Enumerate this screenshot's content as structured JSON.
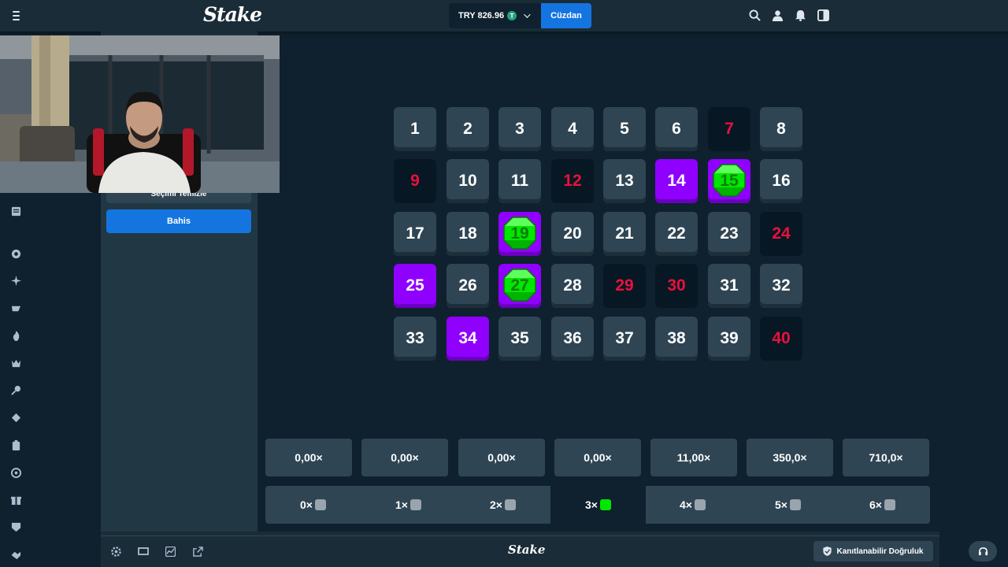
{
  "header": {
    "logo": "Stake",
    "balance": "TRY 826.96",
    "currency_symbol": "T",
    "wallet_label": "Cüzdan"
  },
  "sidebar": {
    "icons": [
      "menu-icon",
      "news-icon",
      "casino-chip-icon",
      "sparkle-icon",
      "sports-icon",
      "fire-icon",
      "crown-icon",
      "racket-icon",
      "poker-icon",
      "clipboard-icon",
      "support-circle-icon",
      "gift-icon",
      "vip-icon",
      "handshake-icon"
    ]
  },
  "controls": {
    "clear_label": "Seçimi Temizle",
    "bet_label": "Bahis"
  },
  "board": {
    "tiles": [
      {
        "n": "1",
        "s": "normal"
      },
      {
        "n": "2",
        "s": "normal"
      },
      {
        "n": "3",
        "s": "normal"
      },
      {
        "n": "4",
        "s": "normal"
      },
      {
        "n": "5",
        "s": "normal"
      },
      {
        "n": "6",
        "s": "normal"
      },
      {
        "n": "7",
        "s": "miss"
      },
      {
        "n": "8",
        "s": "normal"
      },
      {
        "n": "9",
        "s": "miss"
      },
      {
        "n": "10",
        "s": "normal"
      },
      {
        "n": "11",
        "s": "normal"
      },
      {
        "n": "12",
        "s": "miss"
      },
      {
        "n": "13",
        "s": "normal"
      },
      {
        "n": "14",
        "s": "picked"
      },
      {
        "n": "15",
        "s": "gem"
      },
      {
        "n": "16",
        "s": "normal"
      },
      {
        "n": "17",
        "s": "normal"
      },
      {
        "n": "18",
        "s": "normal"
      },
      {
        "n": "19",
        "s": "gem"
      },
      {
        "n": "20",
        "s": "normal"
      },
      {
        "n": "21",
        "s": "normal"
      },
      {
        "n": "22",
        "s": "normal"
      },
      {
        "n": "23",
        "s": "normal"
      },
      {
        "n": "24",
        "s": "miss"
      },
      {
        "n": "25",
        "s": "picked"
      },
      {
        "n": "26",
        "s": "normal"
      },
      {
        "n": "27",
        "s": "gem"
      },
      {
        "n": "28",
        "s": "normal"
      },
      {
        "n": "29",
        "s": "miss"
      },
      {
        "n": "30",
        "s": "miss"
      },
      {
        "n": "31",
        "s": "normal"
      },
      {
        "n": "32",
        "s": "normal"
      },
      {
        "n": "33",
        "s": "normal"
      },
      {
        "n": "34",
        "s": "picked"
      },
      {
        "n": "35",
        "s": "normal"
      },
      {
        "n": "36",
        "s": "normal"
      },
      {
        "n": "37",
        "s": "normal"
      },
      {
        "n": "38",
        "s": "normal"
      },
      {
        "n": "39",
        "s": "normal"
      },
      {
        "n": "40",
        "s": "miss"
      }
    ]
  },
  "payouts": [
    "0,00×",
    "0,00×",
    "0,00×",
    "0,00×",
    "11,00×",
    "350,0×",
    "710,0×"
  ],
  "hits": [
    {
      "label": "0×",
      "active": false
    },
    {
      "label": "1×",
      "active": false
    },
    {
      "label": "2×",
      "active": false
    },
    {
      "label": "3×",
      "active": true
    },
    {
      "label": "4×",
      "active": false
    },
    {
      "label": "5×",
      "active": false
    },
    {
      "label": "6×",
      "active": false
    }
  ],
  "footer": {
    "logo": "Stake",
    "fairness_label": "Kanıtlanabilir Doğruluk"
  },
  "colors": {
    "accent": "#1475e1",
    "picked": "#9000ff",
    "gem": "#00e701",
    "miss_text": "#e9113c",
    "tile": "#2f4553"
  }
}
